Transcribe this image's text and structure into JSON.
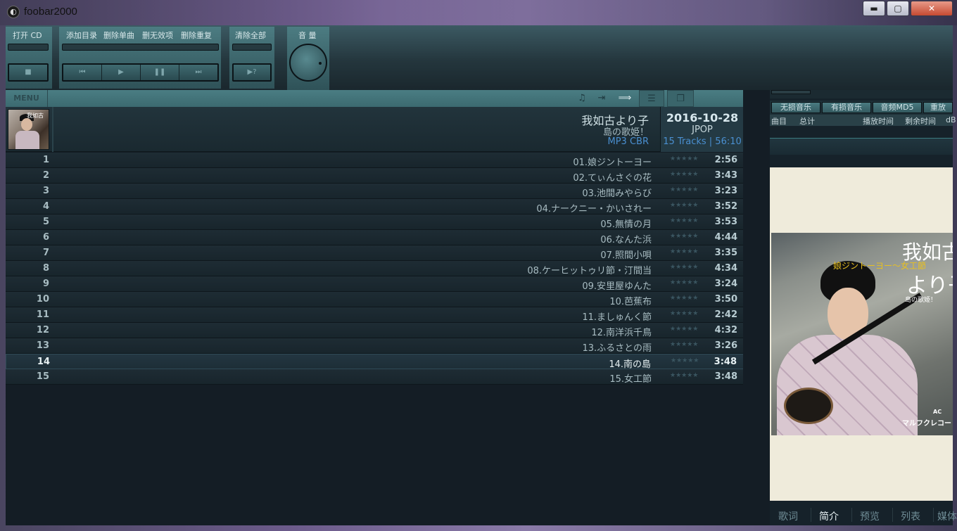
{
  "window": {
    "title": "foobar2000",
    "controls": {
      "minimize": "▬",
      "maximize": "▢",
      "close": "✕"
    }
  },
  "toolbar": {
    "open_cd": "打开 CD",
    "add_dir": "添加目录",
    "delete_single": "删除单曲",
    "delete_invalid": "删无效项",
    "delete_dup": "删除重复",
    "clear_all": "清除全部",
    "volume": "音 量",
    "buttons": {
      "stop": "■",
      "prev": "⏮",
      "play": "▶",
      "pause": "❚❚",
      "next": "⏭",
      "random": "▶?"
    }
  },
  "nav": {
    "menu": "MENU",
    "icons": [
      "music-note-icon",
      "import-icon",
      "arrow-right-icon",
      "list-icon",
      "window-icon"
    ]
  },
  "album": {
    "title": "我如古より子",
    "subtitle": "島の歌姫！",
    "codec": "MP3 CBR",
    "date": "2016-10-28",
    "genre": "JPOP",
    "info": "15 Tracks | 56:10",
    "thumb_text": "我如古"
  },
  "tracks": [
    {
      "num": "1",
      "title": "01.娘ジントーヨー",
      "stars": "★★★★★",
      "dur": "2:56"
    },
    {
      "num": "2",
      "title": "02.てぃんさぐの花",
      "stars": "★★★★★",
      "dur": "3:43"
    },
    {
      "num": "3",
      "title": "03.池間みやらび",
      "stars": "★★★★★",
      "dur": "3:23"
    },
    {
      "num": "4",
      "title": "04.ナークニー・かいされー",
      "stars": "★★★★★",
      "dur": "3:52"
    },
    {
      "num": "5",
      "title": "05.無情の月",
      "stars": "★★★★★",
      "dur": "3:53"
    },
    {
      "num": "6",
      "title": "06.なんた浜",
      "stars": "★★★★★",
      "dur": "4:44"
    },
    {
      "num": "7",
      "title": "07.照間小唄",
      "stars": "★★★★★",
      "dur": "3:35"
    },
    {
      "num": "8",
      "title": "08.ケーヒットゥリ節・汀間当",
      "stars": "★★★★★",
      "dur": "4:34"
    },
    {
      "num": "9",
      "title": "09.安里屋ゆんた",
      "stars": "★★★★★",
      "dur": "3:24"
    },
    {
      "num": "10",
      "title": "10.芭蕉布",
      "stars": "★★★★★",
      "dur": "3:50"
    },
    {
      "num": "11",
      "title": "11.ましゅんく節",
      "stars": "★★★★★",
      "dur": "2:42"
    },
    {
      "num": "12",
      "title": "12.南洋浜千鳥",
      "stars": "★★★★★",
      "dur": "4:32"
    },
    {
      "num": "13",
      "title": "13.ふるさとの雨",
      "stars": "★★★★★",
      "dur": "3:26"
    },
    {
      "num": "14",
      "title": "14.南の島",
      "stars": "★★★★★",
      "dur": "3:48",
      "selected": true
    },
    {
      "num": "15",
      "title": "15.女工節",
      "stars": "★★★★★",
      "dur": "3:48"
    }
  ],
  "right_panel": {
    "tabs": [
      "无损音乐",
      "有损音乐",
      "音频MD5",
      "重放"
    ],
    "columns": [
      "曲目",
      "总计",
      "播放时间",
      "剩余时间",
      "dB"
    ],
    "cover": {
      "title1": "我如古",
      "subtitle1": "娘ジントーヨー～女工節",
      "title2": "より子",
      "subtitle2": "島の歌姫！",
      "label": "マルフクレコード",
      "label_top": "AC"
    },
    "bottom_tabs": [
      "歌词",
      "简介",
      "预览",
      "列表",
      "媒体"
    ],
    "active_bottom_tab": "简介"
  },
  "colors": {
    "accent": "#4a8fd0",
    "toolbar": "#4c7c82",
    "background": "#141d25"
  }
}
